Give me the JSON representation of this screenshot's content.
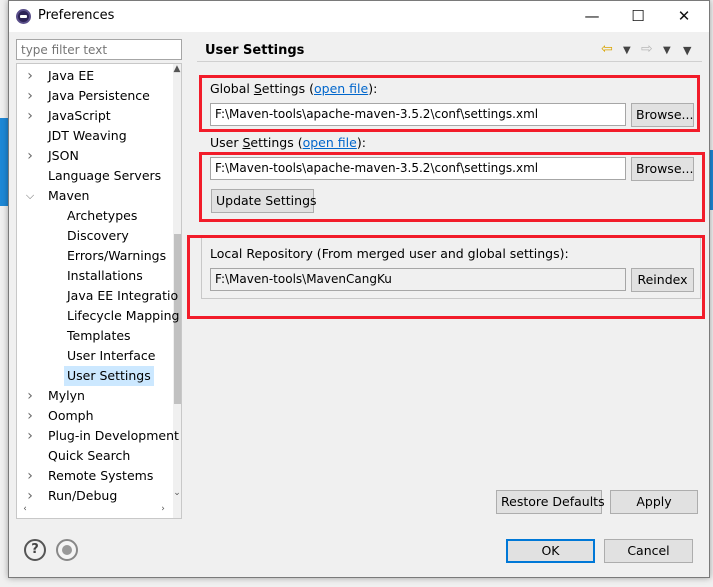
{
  "window": {
    "title": "Preferences",
    "minimize_glyph": "—",
    "maximize_glyph": "☐",
    "close_glyph": "✕"
  },
  "filter": {
    "placeholder": "type filter text"
  },
  "tree": {
    "items": [
      {
        "label": "Java EE",
        "expandable": true,
        "expanded": false,
        "level": 0
      },
      {
        "label": "Java Persistence",
        "expandable": true,
        "expanded": false,
        "level": 0
      },
      {
        "label": "JavaScript",
        "expandable": true,
        "expanded": false,
        "level": 0
      },
      {
        "label": "JDT Weaving",
        "expandable": false,
        "expanded": false,
        "level": 0
      },
      {
        "label": "JSON",
        "expandable": true,
        "expanded": false,
        "level": 0
      },
      {
        "label": "Language Servers",
        "expandable": false,
        "expanded": false,
        "level": 0
      },
      {
        "label": "Maven",
        "expandable": true,
        "expanded": true,
        "level": 0
      },
      {
        "label": "Archetypes",
        "expandable": false,
        "expanded": false,
        "level": 1
      },
      {
        "label": "Discovery",
        "expandable": false,
        "expanded": false,
        "level": 1
      },
      {
        "label": "Errors/Warnings",
        "expandable": false,
        "expanded": false,
        "level": 1
      },
      {
        "label": "Installations",
        "expandable": false,
        "expanded": false,
        "level": 1
      },
      {
        "label": "Java EE Integratio",
        "expandable": false,
        "expanded": false,
        "level": 1
      },
      {
        "label": "Lifecycle Mapping",
        "expandable": false,
        "expanded": false,
        "level": 1
      },
      {
        "label": "Templates",
        "expandable": false,
        "expanded": false,
        "level": 1
      },
      {
        "label": "User Interface",
        "expandable": false,
        "expanded": false,
        "level": 1
      },
      {
        "label": "User Settings",
        "expandable": false,
        "expanded": false,
        "level": 1,
        "selected": true
      },
      {
        "label": "Mylyn",
        "expandable": true,
        "expanded": false,
        "level": 0
      },
      {
        "label": "Oomph",
        "expandable": true,
        "expanded": false,
        "level": 0
      },
      {
        "label": "Plug-in Development",
        "expandable": true,
        "expanded": false,
        "level": 0
      },
      {
        "label": "Quick Search",
        "expandable": false,
        "expanded": false,
        "level": 0
      },
      {
        "label": "Remote Systems",
        "expandable": true,
        "expanded": false,
        "level": 0
      },
      {
        "label": "Run/Debug",
        "expandable": true,
        "expanded": false,
        "level": 0
      }
    ]
  },
  "pane": {
    "title": "User Settings",
    "global": {
      "label_pre": "Global ",
      "label_underlined": "S",
      "label_post": "ettings (",
      "link": "open file",
      "label_end": "):",
      "value": "F:\\Maven-tools\\apache-maven-3.5.2\\conf\\settings.xml",
      "browse_label": "Browse..."
    },
    "user": {
      "label_pre": "User ",
      "label_underlined": "S",
      "label_post": "ettings (",
      "link": "open file",
      "label_end": "):",
      "value": "F:\\Maven-tools\\apache-maven-3.5.2\\conf\\settings.xml",
      "browse_label": "Browse...",
      "update_label": "Update Settings"
    },
    "local": {
      "label": "Local Repository (From merged user and global settings):",
      "value": "F:\\Maven-tools\\MavenCangKu",
      "reindex_label": "Reindex"
    },
    "restore_defaults_label": "Restore Defaults",
    "apply_label": "Apply"
  },
  "footer": {
    "help_glyph": "?",
    "ok_label": "OK",
    "cancel_label": "Cancel"
  },
  "colors": {
    "highlight": "#f21c2a",
    "link": "#0066cc",
    "selection": "#cce8ff",
    "default_button_border": "#0078d7"
  }
}
